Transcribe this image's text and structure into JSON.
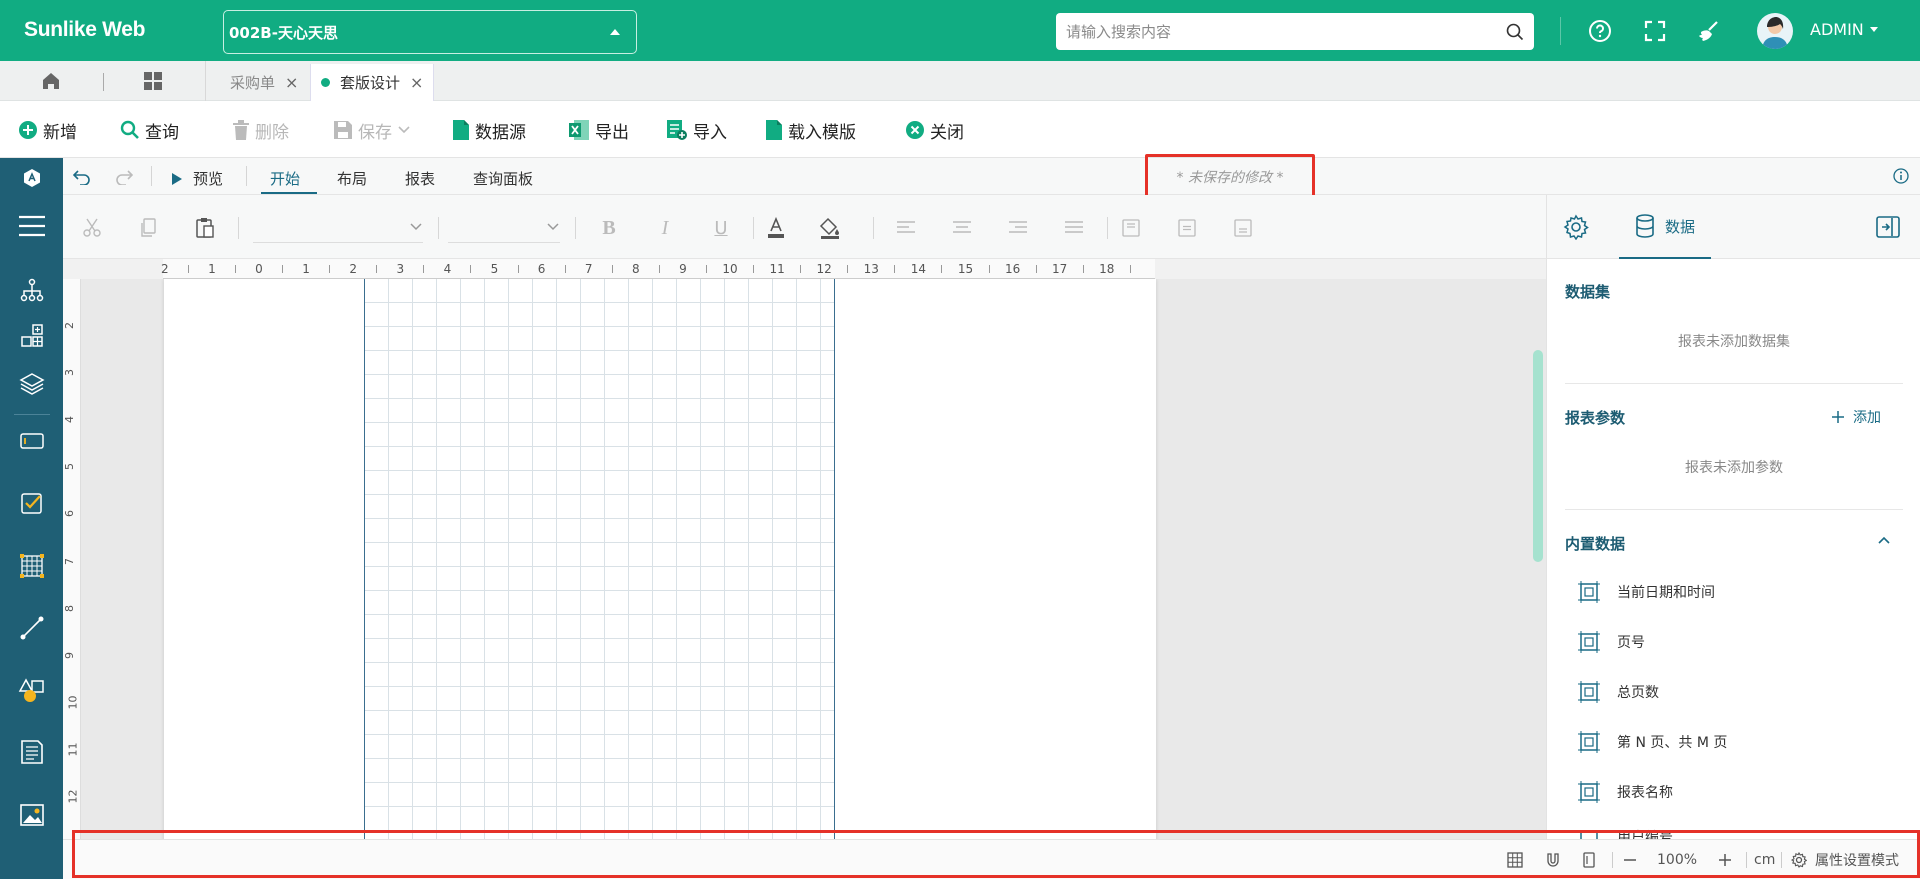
{
  "app": {
    "brand": "Sunlike Web",
    "company": "002B-天心天思",
    "search_placeholder": "请输入搜索内容",
    "user": "ADMIN"
  },
  "tabs": [
    {
      "label": "采购单",
      "active": false
    },
    {
      "label": "套版设计",
      "active": true
    }
  ],
  "toolbar": {
    "new": "新增",
    "query": "查询",
    "delete": "删除",
    "save": "保存",
    "datasource": "数据源",
    "export": "导出",
    "import": "导入",
    "load_template": "载入模版",
    "close": "关闭"
  },
  "designer": {
    "preview": "预览",
    "tabs": [
      "开始",
      "布局",
      "报表",
      "查询面板"
    ],
    "unsaved": "* 未保存的修改 *"
  },
  "ruler": {
    "h_labels": [
      "2",
      "1",
      "0",
      "1",
      "2",
      "3",
      "4",
      "5",
      "6",
      "7",
      "8",
      "9",
      "10",
      "11",
      "12",
      "13",
      "14",
      "15",
      "16",
      "17",
      "18"
    ],
    "v_labels": [
      "2",
      "3",
      "4",
      "5",
      "6",
      "7",
      "8",
      "9",
      "10",
      "11",
      "12"
    ]
  },
  "right_panel": {
    "tab_data": "数据",
    "datasets_title": "数据集",
    "datasets_empty": "报表未添加数据集",
    "params_title": "报表参数",
    "params_add": "添加",
    "params_empty": "报表未添加参数",
    "builtin_title": "内置数据",
    "builtin_items": [
      "当前日期和时间",
      "页号",
      "总页数",
      "第 N 页、共 M 页",
      "报表名称",
      "用户编号"
    ]
  },
  "status": {
    "zoom": "100%",
    "unit": "cm",
    "mode": "属性设置模式"
  },
  "colors": {
    "primary": "#11ac82",
    "sidebar": "#1f5f75",
    "accent": "#1a6b85",
    "highlight": "#e53128"
  }
}
